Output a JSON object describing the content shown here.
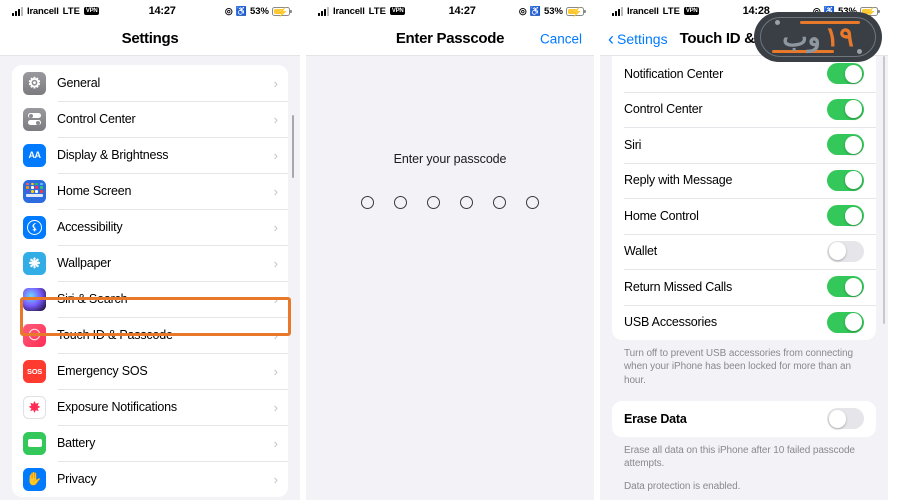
{
  "status_bar": {
    "carrier": "Irancell",
    "network": "LTE",
    "vpn_badge": "VPN",
    "location_icon": "location-arrow-icon",
    "headphones_icon": "headphones-icon",
    "battery_percent": "53%",
    "battery_icon": "battery-charging-icon",
    "signal_icon": "cellular-signal-icon"
  },
  "panel1": {
    "time": "14:27",
    "nav_title": "Settings",
    "items": [
      {
        "label": "General",
        "icon": "gear-icon",
        "chevron": "›"
      },
      {
        "label": "Control Center",
        "icon": "control-center-icon",
        "chevron": "›"
      },
      {
        "label": "Display & Brightness",
        "icon": "display-brightness-icon",
        "chevron": "›"
      },
      {
        "label": "Home Screen",
        "icon": "home-screen-icon",
        "chevron": "›"
      },
      {
        "label": "Accessibility",
        "icon": "accessibility-icon",
        "chevron": "›"
      },
      {
        "label": "Wallpaper",
        "icon": "wallpaper-icon",
        "chevron": "›"
      },
      {
        "label": "Siri & Search",
        "icon": "siri-icon",
        "chevron": "›"
      },
      {
        "label": "Touch ID & Passcode",
        "icon": "touch-id-icon",
        "chevron": "›"
      },
      {
        "label": "Emergency SOS",
        "icon": "emergency-sos-icon",
        "chevron": "›"
      },
      {
        "label": "Exposure Notifications",
        "icon": "exposure-notifications-icon",
        "chevron": "›"
      },
      {
        "label": "Battery",
        "icon": "battery-icon",
        "chevron": "›"
      },
      {
        "label": "Privacy",
        "icon": "privacy-hand-icon",
        "chevron": "›"
      }
    ],
    "highlight": {
      "target_label": "Touch ID & Passcode",
      "color": "#e8792a"
    }
  },
  "panel2": {
    "time": "14:27",
    "nav_title": "Enter Passcode",
    "cancel_label": "Cancel",
    "cancel_color": "#007aff",
    "prompt": "Enter your passcode",
    "passcode_digits": 6,
    "entered_digits": 0
  },
  "panel3": {
    "time": "14:28",
    "back_label": "Settings",
    "back_icon": "chevron-left-icon",
    "nav_title": "Touch ID & Passcode",
    "rows": [
      {
        "label": "Notification Center",
        "state": "on"
      },
      {
        "label": "Control Center",
        "state": "on"
      },
      {
        "label": "Siri",
        "state": "on"
      },
      {
        "label": "Reply with Message",
        "state": "on"
      },
      {
        "label": "Home Control",
        "state": "on"
      },
      {
        "label": "Wallet",
        "state": "off"
      },
      {
        "label": "Return Missed Calls",
        "state": "on"
      },
      {
        "label": "USB Accessories",
        "state": "on"
      }
    ],
    "usb_footnote": "Turn off to prevent USB accessories from connecting when your iPhone has been locked for more than an hour.",
    "erase_row": {
      "label": "Erase Data",
      "state": "off"
    },
    "erase_footnote": "Erase all data on this iPhone after 10 failed passcode attempts.",
    "protection_footnote": "Data protection is enabled."
  },
  "watermark": {
    "text_gray": "وب",
    "text_orange": "۱۹",
    "bg_color": "#3a3f45",
    "accent_color": "#e8792a"
  }
}
